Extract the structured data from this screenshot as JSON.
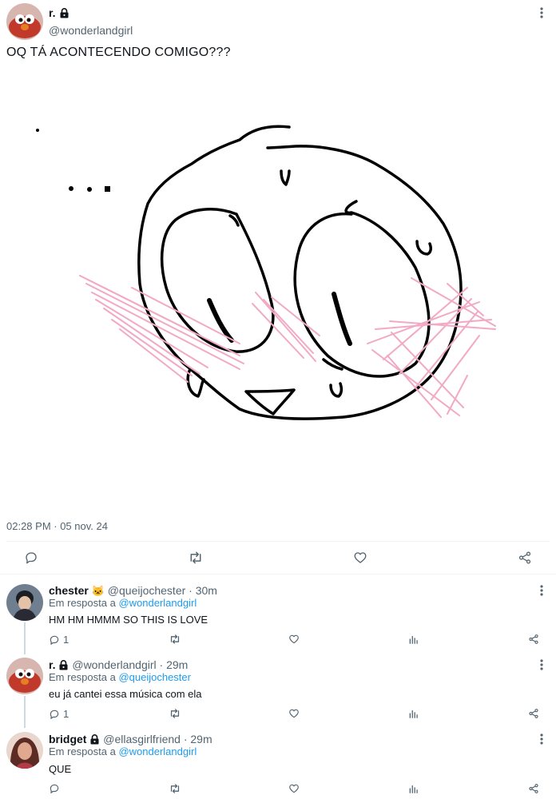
{
  "main_tweet": {
    "display_name": "r.",
    "handle": "@wonderlandgirl",
    "text": "OQ TÁ ACONTECENDO COMIGO???",
    "timestamp": "02:28 PM · 05 nov. 24",
    "avatar_color": "#c0392b"
  },
  "replies": [
    {
      "display_name": "chester",
      "name_emoji": "🐱",
      "handle": "@queijochester",
      "time": "· 30m",
      "reply_to_prefix": "Em resposta a",
      "reply_to": "@wonderlandgirl",
      "text": "HM HM HMMM SO THIS IS LOVE",
      "reply_count": "1"
    },
    {
      "display_name": "r.",
      "handle": "@wonderlandgirl",
      "time": "· 29m",
      "reply_to_prefix": "Em resposta a",
      "reply_to": "@queijochester",
      "text": "eu já cantei essa música com ela",
      "reply_count": "1"
    },
    {
      "display_name": "bridget",
      "handle": "@ellasgirlfriend",
      "time": "· 29m",
      "reply_to_prefix": "Em resposta a",
      "reply_to": "@wonderlandgirl",
      "text": "QUE",
      "reply_count": ""
    }
  ],
  "icons": {
    "reply": "reply-icon",
    "retweet": "retweet-icon",
    "like": "like-icon",
    "share": "share-icon",
    "views": "views-icon",
    "more": "more-icon",
    "lock": "lock-icon"
  },
  "colors": {
    "link": "#1d9bf0",
    "muted": "#536471",
    "blush": "#f2a9c4"
  }
}
